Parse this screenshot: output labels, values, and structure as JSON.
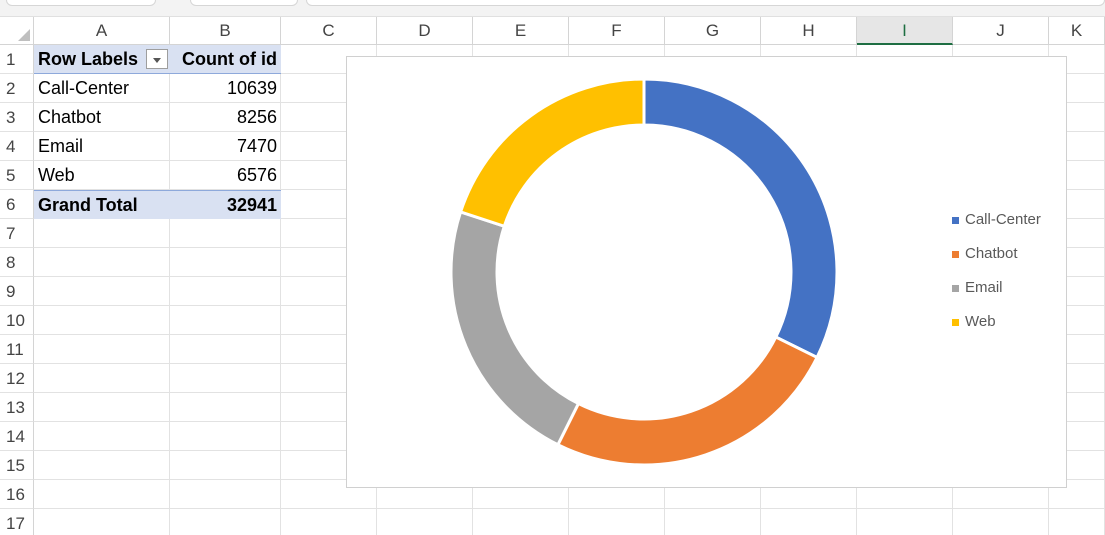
{
  "spreadsheet": {
    "columns": [
      "A",
      "B",
      "C",
      "D",
      "E",
      "F",
      "G",
      "H",
      "I",
      "J",
      "K"
    ],
    "selected_column": "I",
    "rows": [
      "1",
      "2",
      "3",
      "4",
      "5",
      "6",
      "7",
      "8",
      "9",
      "10",
      "11",
      "12",
      "13",
      "14",
      "15",
      "16",
      "17"
    ]
  },
  "pivot": {
    "header_row_labels": "Row Labels",
    "header_count": "Count of id",
    "rows": [
      {
        "label": "Call-Center",
        "value": "10639"
      },
      {
        "label": "Chatbot",
        "value": "8256"
      },
      {
        "label": "Email",
        "value": "7470"
      },
      {
        "label": "Web",
        "value": "6576"
      }
    ],
    "total_label": "Grand Total",
    "total_value": "32941"
  },
  "chart_data": {
    "type": "pie",
    "style": "doughnut",
    "categories": [
      "Call-Center",
      "Chatbot",
      "Email",
      "Web"
    ],
    "values": [
      10639,
      8256,
      7470,
      6576
    ],
    "colors": [
      "#4472c4",
      "#ed7d31",
      "#a5a5a5",
      "#ffc000"
    ],
    "title": "",
    "legend_position": "right"
  }
}
